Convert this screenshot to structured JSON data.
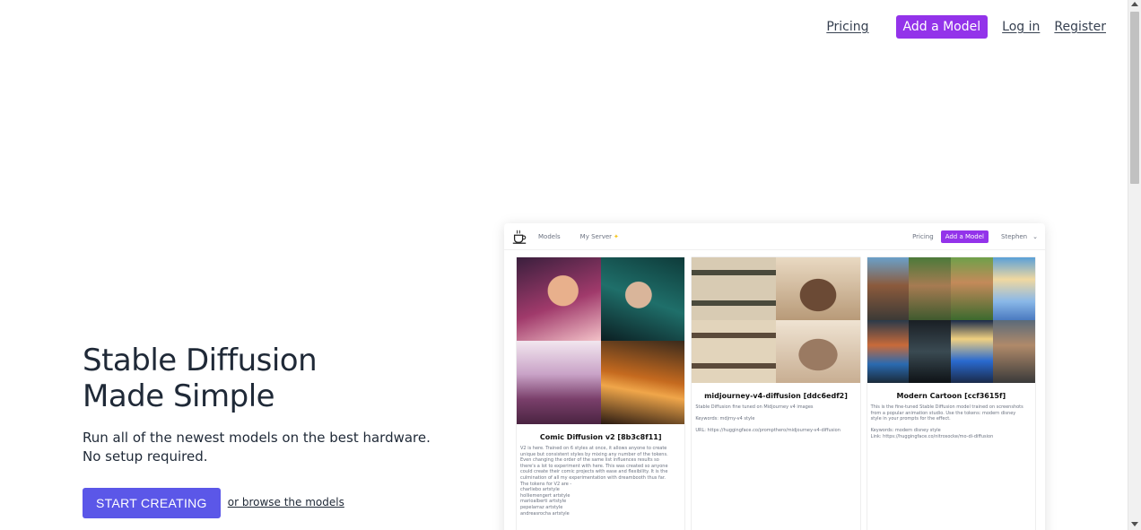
{
  "nav": {
    "pricing": "Pricing",
    "add_model": "Add a Model",
    "login": "Log in",
    "register": "Register"
  },
  "hero": {
    "title_line1": "Stable Diffusion",
    "title_line2": "Made Simple",
    "subtitle": "Run all of the newest models on the best hardware. No setup required.",
    "cta": "START CREATING",
    "browse": "or browse the models"
  },
  "preview": {
    "nav": {
      "models": "Models",
      "my_server": "My Server",
      "pricing": "Pricing",
      "add_model": "Add a Model",
      "user": "Stephen"
    },
    "cards": [
      {
        "title": "Comic Diffusion v2 [8b3c8f11]",
        "description_lines": [
          "V2 is here. Trained on 6 styles at once, it allows anyone to create",
          "unique but consistent styles by mixing any number of the tokens.",
          "Even changing the order of the same list influences results so",
          "there's a lot to experiment with here. This was created so anyone",
          "could create their comic projects with ease and flexibility. It is the",
          "culmination of all my experimentation with dreambooth thus far.",
          "The tokens for V2 are -",
          "charliebo artstyle",
          "holliemengert artstyle",
          "marioalberti artstyle",
          "pepelarraz artstyle",
          "andreasrocha artstyle"
        ]
      },
      {
        "title": "midjourney-v4-diffusion [ddc6edf2]",
        "description_lines": [
          "Stable Diffusion fine tuned on Midjourney v4 images",
          "",
          "Keywords: mdjrny-v4 style",
          "",
          "URL: https://huggingface.co/prompthero/midjourney-v4-diffusion"
        ]
      },
      {
        "title": "Modern Cartoon [ccf3615f]",
        "description_lines": [
          "This is the fine-tuned Stable Diffusion model trained on screenshots",
          "from a popular animation studio. Use the tokens: modern disney",
          "style in your prompts for the effect.",
          "",
          "Keywords: modern disney style",
          "Link: https://huggingface.co/nitrosocke/mo-di-diffusion"
        ]
      }
    ]
  },
  "colors": {
    "accent_purple": "#9333ea",
    "cta_indigo": "#5b57e8"
  }
}
